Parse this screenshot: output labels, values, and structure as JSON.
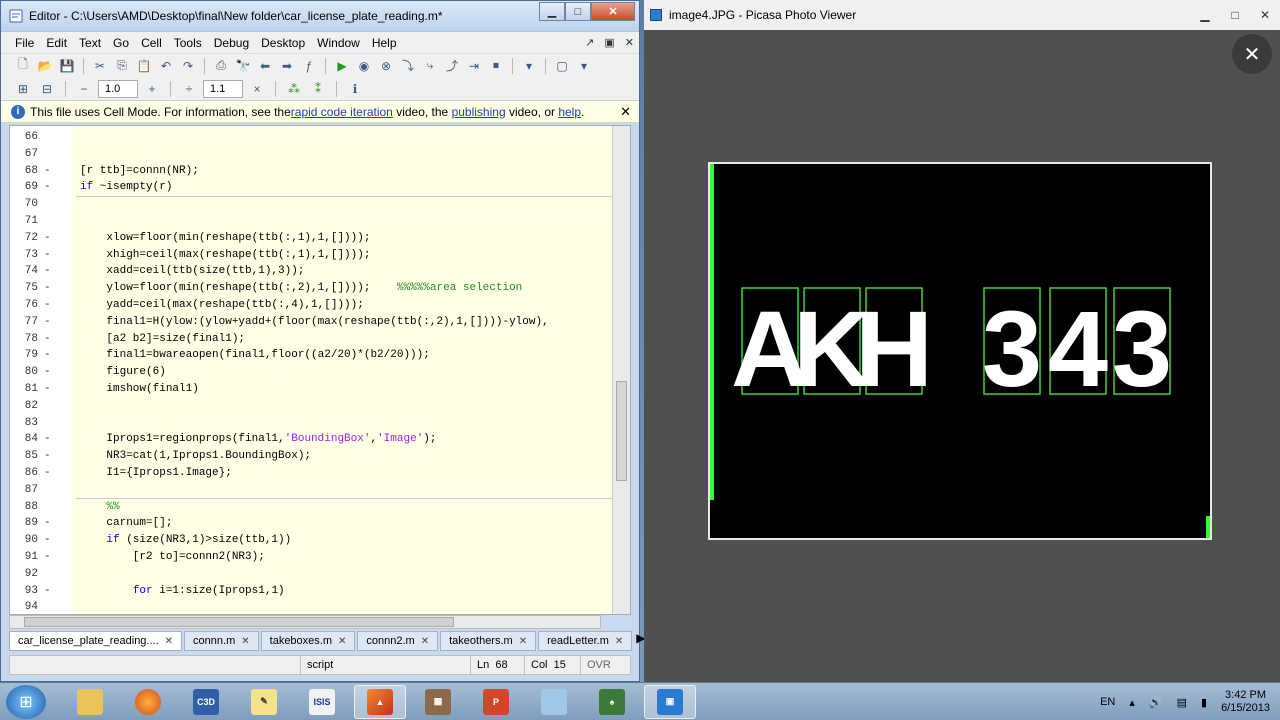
{
  "editor": {
    "title": "Editor - C:\\Users\\AMD\\Desktop\\final\\New folder\\car_license_plate_reading.m*",
    "menu": [
      "File",
      "Edit",
      "Text",
      "Go",
      "Cell",
      "Tools",
      "Debug",
      "Desktop",
      "Window",
      "Help"
    ],
    "toolbar2": {
      "minus": "−",
      "value1": "1.0",
      "plus": "+",
      "div": "÷",
      "value2": "1.1",
      "times": "×"
    },
    "info": {
      "prefix": "This file uses Cell Mode. For information, see the ",
      "link1": "rapid code iteration",
      "mid": " video, the ",
      "link2": "publishing",
      "mid2": " video, or ",
      "link3": "help",
      "suffix": "."
    },
    "lines": [
      {
        "n": "66",
        "dash": "",
        "code": ""
      },
      {
        "n": "67",
        "dash": "",
        "code": ""
      },
      {
        "n": "68",
        "dash": "-",
        "code": "[r ttb]=connn(NR);"
      },
      {
        "n": "69",
        "dash": "-",
        "code": "if ~isempty(r)"
      },
      {
        "n": "70",
        "dash": "",
        "code": ""
      },
      {
        "n": "71",
        "dash": "",
        "code": ""
      },
      {
        "n": "72",
        "dash": "-",
        "code": "    xlow=floor(min(reshape(ttb(:,1),1,[])));"
      },
      {
        "n": "73",
        "dash": "-",
        "code": "    xhigh=ceil(max(reshape(ttb(:,1),1,[])));"
      },
      {
        "n": "74",
        "dash": "-",
        "code": "    xadd=ceil(ttb(size(ttb,1),3));"
      },
      {
        "n": "75",
        "dash": "-",
        "code": "    ylow=floor(min(reshape(ttb(:,2),1,[])));"
      },
      {
        "n": "76",
        "dash": "-",
        "code": "    yadd=ceil(max(reshape(ttb(:,4),1,[])));"
      },
      {
        "n": "77",
        "dash": "-",
        "code": "    final1=H(ylow:(ylow+yadd+(floor(max(reshape(ttb(:,2),1,[])))-ylow),"
      },
      {
        "n": "78",
        "dash": "-",
        "code": "    [a2 b2]=size(final1);"
      },
      {
        "n": "79",
        "dash": "-",
        "code": "    final1=bwareaopen(final1,floor((a2/20)*(b2/20)));"
      },
      {
        "n": "80",
        "dash": "-",
        "code": "    figure(6)"
      },
      {
        "n": "81",
        "dash": "-",
        "code": "    imshow(final1)"
      },
      {
        "n": "82",
        "dash": "",
        "code": ""
      },
      {
        "n": "83",
        "dash": "",
        "code": ""
      },
      {
        "n": "84",
        "dash": "-",
        "code": "    Iprops1=regionprops(final1,'BoundingBox','Image');"
      },
      {
        "n": "85",
        "dash": "-",
        "code": "    NR3=cat(1,Iprops1.BoundingBox);"
      },
      {
        "n": "86",
        "dash": "-",
        "code": "    I1={Iprops1.Image};"
      },
      {
        "n": "87",
        "dash": "",
        "code": ""
      },
      {
        "n": "88",
        "dash": "",
        "code": "    %%"
      },
      {
        "n": "89",
        "dash": "-",
        "code": "    carnum=[];"
      },
      {
        "n": "90",
        "dash": "-",
        "code": "    if (size(NR3,1)>size(ttb,1))"
      },
      {
        "n": "91",
        "dash": "-",
        "code": "        [r2 to]=connn2(NR3);"
      },
      {
        "n": "92",
        "dash": "",
        "code": ""
      },
      {
        "n": "93",
        "dash": "-",
        "code": "        for i=1:size(Iprops1,1)"
      },
      {
        "n": "94",
        "dash": "",
        "code": ""
      }
    ],
    "comment75": "%%%%%area selection",
    "tabs": [
      "car_license_plate_reading....",
      "connn.m",
      "takeboxes.m",
      "connn2.m",
      "takeothers.m",
      "readLetter.m"
    ],
    "status": {
      "mode": "script",
      "ln_label": "Ln",
      "ln": "68",
      "col_label": "Col",
      "col": "15",
      "ovr": "OVR"
    }
  },
  "picasa": {
    "title": "image4.JPG - Picasa Photo Viewer",
    "plate_chars": [
      "A",
      "K",
      "H",
      "3",
      "4",
      "3"
    ]
  },
  "taskbar": {
    "apps": [
      "explorer",
      "firefox",
      "calc3d",
      "notes",
      "isis",
      "matlab",
      "tools",
      "powerpoint",
      "files",
      "game",
      "picasa"
    ],
    "lang": "EN",
    "time": "3:42 PM",
    "date": "6/15/2013"
  }
}
